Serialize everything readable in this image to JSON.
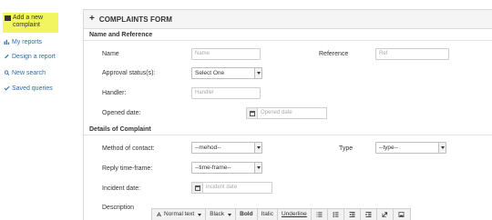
{
  "sidebar": {
    "items": [
      {
        "label_line1": "Add a new",
        "label_line2": "complaint",
        "icon": "plus-square-icon"
      },
      {
        "label": "My reports",
        "icon": "bar-chart-icon"
      },
      {
        "label": "Design a report",
        "icon": "pencil-icon"
      },
      {
        "label": "New search",
        "icon": "search-icon"
      },
      {
        "label": "Saved queries",
        "icon": "check-icon"
      }
    ]
  },
  "panel": {
    "title": "COMPLAINTS FORM",
    "sections": {
      "name_ref": "Name and Reference",
      "details": "Details of Complaint"
    }
  },
  "fields": {
    "name": {
      "label": "Name",
      "placeholder": "Name"
    },
    "reference": {
      "label": "Reference",
      "placeholder": "Ref"
    },
    "approval": {
      "label": "Approval status(s):",
      "value": "Select One"
    },
    "handler": {
      "label": "Handler:",
      "placeholder": "Handler"
    },
    "opened": {
      "label": "Opened date:",
      "placeholder": "Opened date"
    },
    "method": {
      "label": "Method of contact:",
      "value": "--mehod--"
    },
    "type": {
      "label": "Type",
      "value": "--type--"
    },
    "reply": {
      "label": "Reply time-frame:",
      "value": "--time-frame--"
    },
    "incident": {
      "label": "Incident date:",
      "placeholder": "incident date"
    },
    "description": {
      "label": "Description"
    }
  },
  "editor_toolbar": {
    "font_size": "Normal text",
    "color": "Black",
    "bold": "Bold",
    "italic": "Italic",
    "underline": "Underline",
    "icons": [
      "bullet-list-icon",
      "numbered-list-icon",
      "outdent-icon",
      "indent-icon",
      "link-icon",
      "image-icon"
    ]
  },
  "colors": {
    "highlight": "#f3f560",
    "link": "#2a6db5",
    "header_bg": "#f5f5f5"
  }
}
